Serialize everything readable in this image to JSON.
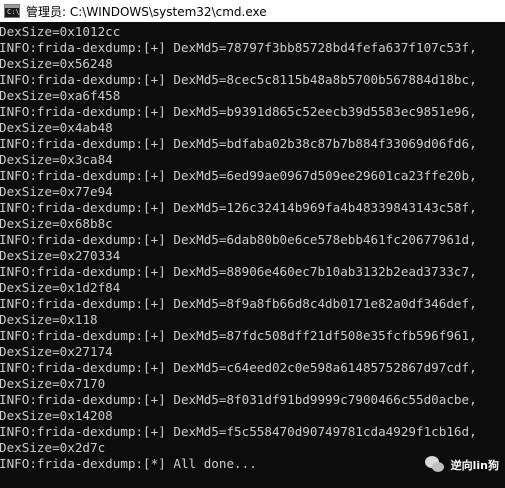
{
  "window": {
    "title": "管理员: C:\\WINDOWS\\system32\\cmd.exe",
    "icon_text": "C:\\"
  },
  "console": {
    "lines": [
      "DexSize=0x1012cc",
      "INFO:frida-dexdump:[+] DexMd5=78797f3bb85728bd4fefa637f107c53f,",
      "DexSize=0x56248",
      "INFO:frida-dexdump:[+] DexMd5=8cec5c8115b48a8b5700b567884d18bc,",
      "DexSize=0xa6f458",
      "INFO:frida-dexdump:[+] DexMd5=b9391d865c52eecb39d5583ec9851e96,",
      "DexSize=0x4ab48",
      "INFO:frida-dexdump:[+] DexMd5=bdfaba02b38c87b7b884f33069d06fd6,",
      "DexSize=0x3ca84",
      "INFO:frida-dexdump:[+] DexMd5=6ed99ae0967d509ee29601ca23ffe20b,",
      "DexSize=0x77e94",
      "INFO:frida-dexdump:[+] DexMd5=126c32414b969fa4b48339843143c58f,",
      "DexSize=0x68b8c",
      "INFO:frida-dexdump:[+] DexMd5=6dab80b0e6ce578ebb461fc20677961d,",
      "DexSize=0x270334",
      "INFO:frida-dexdump:[+] DexMd5=88906e460ec7b10ab3132b2ead3733c7,",
      "DexSize=0x1d2f84",
      "INFO:frida-dexdump:[+] DexMd5=8f9a8fb66d8c4db0171e82a0df346def,",
      "DexSize=0x118",
      "INFO:frida-dexdump:[+] DexMd5=87fdc508dff21df508e35fcfb596f961,",
      "DexSize=0x27174",
      "INFO:frida-dexdump:[+] DexMd5=c64eed02c0e598a61485752867d97cdf,",
      "DexSize=0x7170",
      "INFO:frida-dexdump:[+] DexMd5=8f031df91bd9999c7900466c55d0acbe,",
      "DexSize=0x14208",
      "INFO:frida-dexdump:[+] DexMd5=f5c558470d90749781cda4929f1cb16d,",
      "DexSize=0x2d7c",
      "INFO:frida-dexdump:[*] All done..."
    ]
  },
  "watermark": {
    "text": "逆向lin狗",
    "icon": "wechat-icon"
  }
}
